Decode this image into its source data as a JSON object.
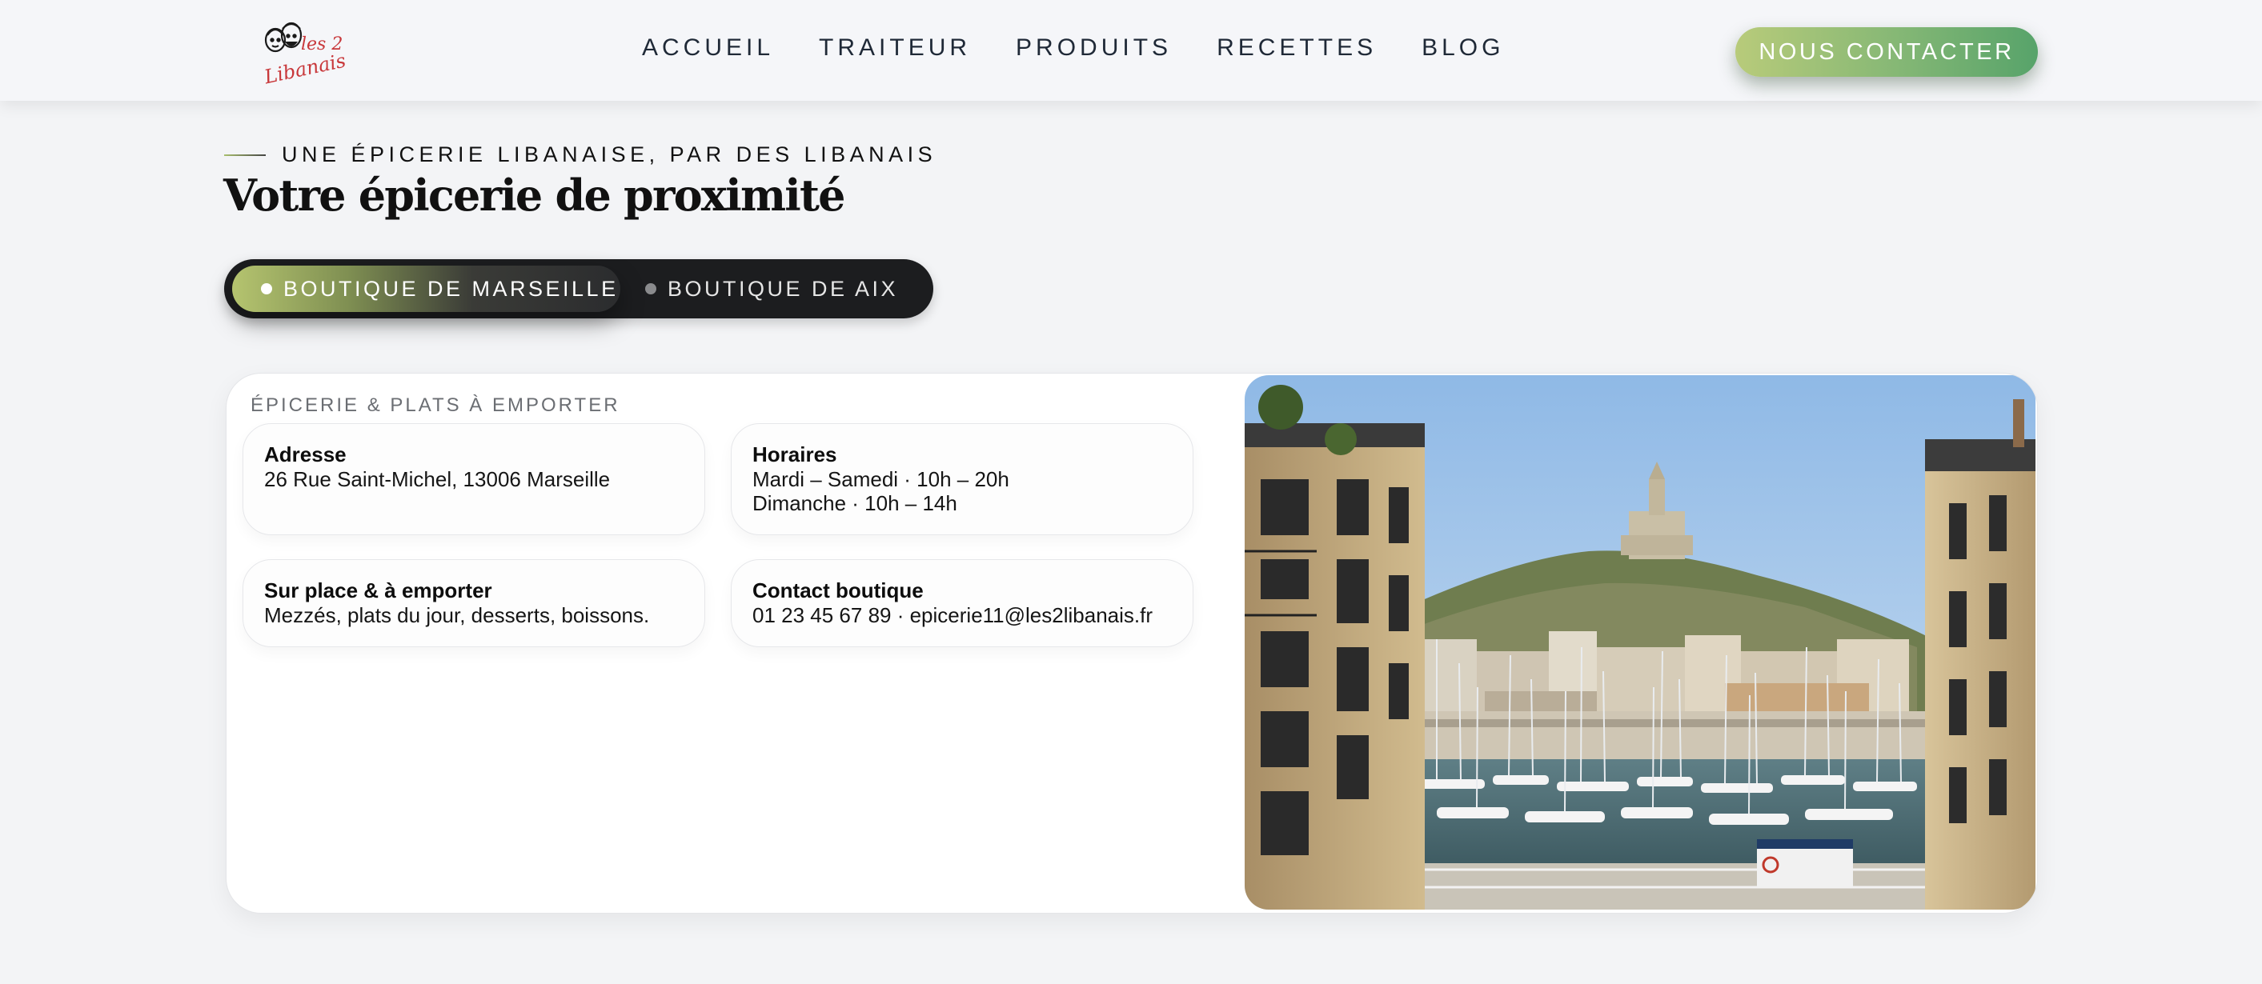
{
  "header": {
    "logo": {
      "text_line1": "les 2",
      "text_line2": "Libanais"
    },
    "nav": [
      {
        "label": "ACCUEIL"
      },
      {
        "label": "TRAITEUR"
      },
      {
        "label": "PRODUITS"
      },
      {
        "label": "RECETTES"
      },
      {
        "label": "BLOG"
      }
    ],
    "cta_label": "NOUS CONTACTER"
  },
  "hero": {
    "eyebrow": "UNE ÉPICERIE LIBANAISE, PAR DES LIBANAIS",
    "title": "Votre épicerie de proximité"
  },
  "tabs": [
    {
      "label": "BOUTIQUE DE MARSEILLE",
      "active": true
    },
    {
      "label": "BOUTIQUE DE AIX",
      "active": false
    }
  ],
  "store": {
    "eyebrow": "ÉPICERIE & PLATS À EMPORTER",
    "adresse": {
      "title": "Adresse",
      "line1": "26 Rue Saint-Michel, 13006 Marseille"
    },
    "horaires": {
      "title": "Horaires",
      "line1": "Mardi – Samedi · 10h – 20h",
      "line2": "Dimanche · 10h – 14h"
    },
    "surplace": {
      "title": "Sur place & à emporter",
      "line1": "Mezzés, plats du jour, desserts, boissons."
    },
    "contact": {
      "title": "Contact boutique",
      "line1": "01 23 45 67 89 · epicerie11@les2libanais.fr"
    },
    "photo_icon": "marseille-harbour-photo"
  },
  "colors": {
    "accent_green_light": "#b8cb7a",
    "accent_green_dark": "#57a36a",
    "logo_red": "#c8373a",
    "tabs_bg": "#1c1d1f"
  }
}
